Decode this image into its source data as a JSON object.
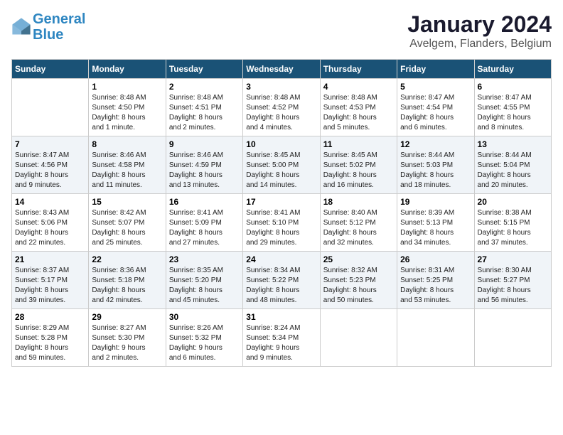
{
  "header": {
    "logo_line1": "General",
    "logo_line2": "Blue",
    "month": "January 2024",
    "location": "Avelgem, Flanders, Belgium"
  },
  "days_of_week": [
    "Sunday",
    "Monday",
    "Tuesday",
    "Wednesday",
    "Thursday",
    "Friday",
    "Saturday"
  ],
  "weeks": [
    [
      {
        "day": "",
        "detail": ""
      },
      {
        "day": "1",
        "detail": "Sunrise: 8:48 AM\nSunset: 4:50 PM\nDaylight: 8 hours\nand 1 minute."
      },
      {
        "day": "2",
        "detail": "Sunrise: 8:48 AM\nSunset: 4:51 PM\nDaylight: 8 hours\nand 2 minutes."
      },
      {
        "day": "3",
        "detail": "Sunrise: 8:48 AM\nSunset: 4:52 PM\nDaylight: 8 hours\nand 4 minutes."
      },
      {
        "day": "4",
        "detail": "Sunrise: 8:48 AM\nSunset: 4:53 PM\nDaylight: 8 hours\nand 5 minutes."
      },
      {
        "day": "5",
        "detail": "Sunrise: 8:47 AM\nSunset: 4:54 PM\nDaylight: 8 hours\nand 6 minutes."
      },
      {
        "day": "6",
        "detail": "Sunrise: 8:47 AM\nSunset: 4:55 PM\nDaylight: 8 hours\nand 8 minutes."
      }
    ],
    [
      {
        "day": "7",
        "detail": "Sunrise: 8:47 AM\nSunset: 4:56 PM\nDaylight: 8 hours\nand 9 minutes."
      },
      {
        "day": "8",
        "detail": "Sunrise: 8:46 AM\nSunset: 4:58 PM\nDaylight: 8 hours\nand 11 minutes."
      },
      {
        "day": "9",
        "detail": "Sunrise: 8:46 AM\nSunset: 4:59 PM\nDaylight: 8 hours\nand 13 minutes."
      },
      {
        "day": "10",
        "detail": "Sunrise: 8:45 AM\nSunset: 5:00 PM\nDaylight: 8 hours\nand 14 minutes."
      },
      {
        "day": "11",
        "detail": "Sunrise: 8:45 AM\nSunset: 5:02 PM\nDaylight: 8 hours\nand 16 minutes."
      },
      {
        "day": "12",
        "detail": "Sunrise: 8:44 AM\nSunset: 5:03 PM\nDaylight: 8 hours\nand 18 minutes."
      },
      {
        "day": "13",
        "detail": "Sunrise: 8:44 AM\nSunset: 5:04 PM\nDaylight: 8 hours\nand 20 minutes."
      }
    ],
    [
      {
        "day": "14",
        "detail": "Sunrise: 8:43 AM\nSunset: 5:06 PM\nDaylight: 8 hours\nand 22 minutes."
      },
      {
        "day": "15",
        "detail": "Sunrise: 8:42 AM\nSunset: 5:07 PM\nDaylight: 8 hours\nand 25 minutes."
      },
      {
        "day": "16",
        "detail": "Sunrise: 8:41 AM\nSunset: 5:09 PM\nDaylight: 8 hours\nand 27 minutes."
      },
      {
        "day": "17",
        "detail": "Sunrise: 8:41 AM\nSunset: 5:10 PM\nDaylight: 8 hours\nand 29 minutes."
      },
      {
        "day": "18",
        "detail": "Sunrise: 8:40 AM\nSunset: 5:12 PM\nDaylight: 8 hours\nand 32 minutes."
      },
      {
        "day": "19",
        "detail": "Sunrise: 8:39 AM\nSunset: 5:13 PM\nDaylight: 8 hours\nand 34 minutes."
      },
      {
        "day": "20",
        "detail": "Sunrise: 8:38 AM\nSunset: 5:15 PM\nDaylight: 8 hours\nand 37 minutes."
      }
    ],
    [
      {
        "day": "21",
        "detail": "Sunrise: 8:37 AM\nSunset: 5:17 PM\nDaylight: 8 hours\nand 39 minutes."
      },
      {
        "day": "22",
        "detail": "Sunrise: 8:36 AM\nSunset: 5:18 PM\nDaylight: 8 hours\nand 42 minutes."
      },
      {
        "day": "23",
        "detail": "Sunrise: 8:35 AM\nSunset: 5:20 PM\nDaylight: 8 hours\nand 45 minutes."
      },
      {
        "day": "24",
        "detail": "Sunrise: 8:34 AM\nSunset: 5:22 PM\nDaylight: 8 hours\nand 48 minutes."
      },
      {
        "day": "25",
        "detail": "Sunrise: 8:32 AM\nSunset: 5:23 PM\nDaylight: 8 hours\nand 50 minutes."
      },
      {
        "day": "26",
        "detail": "Sunrise: 8:31 AM\nSunset: 5:25 PM\nDaylight: 8 hours\nand 53 minutes."
      },
      {
        "day": "27",
        "detail": "Sunrise: 8:30 AM\nSunset: 5:27 PM\nDaylight: 8 hours\nand 56 minutes."
      }
    ],
    [
      {
        "day": "28",
        "detail": "Sunrise: 8:29 AM\nSunset: 5:28 PM\nDaylight: 8 hours\nand 59 minutes."
      },
      {
        "day": "29",
        "detail": "Sunrise: 8:27 AM\nSunset: 5:30 PM\nDaylight: 9 hours\nand 2 minutes."
      },
      {
        "day": "30",
        "detail": "Sunrise: 8:26 AM\nSunset: 5:32 PM\nDaylight: 9 hours\nand 6 minutes."
      },
      {
        "day": "31",
        "detail": "Sunrise: 8:24 AM\nSunset: 5:34 PM\nDaylight: 9 hours\nand 9 minutes."
      },
      {
        "day": "",
        "detail": ""
      },
      {
        "day": "",
        "detail": ""
      },
      {
        "day": "",
        "detail": ""
      }
    ]
  ]
}
